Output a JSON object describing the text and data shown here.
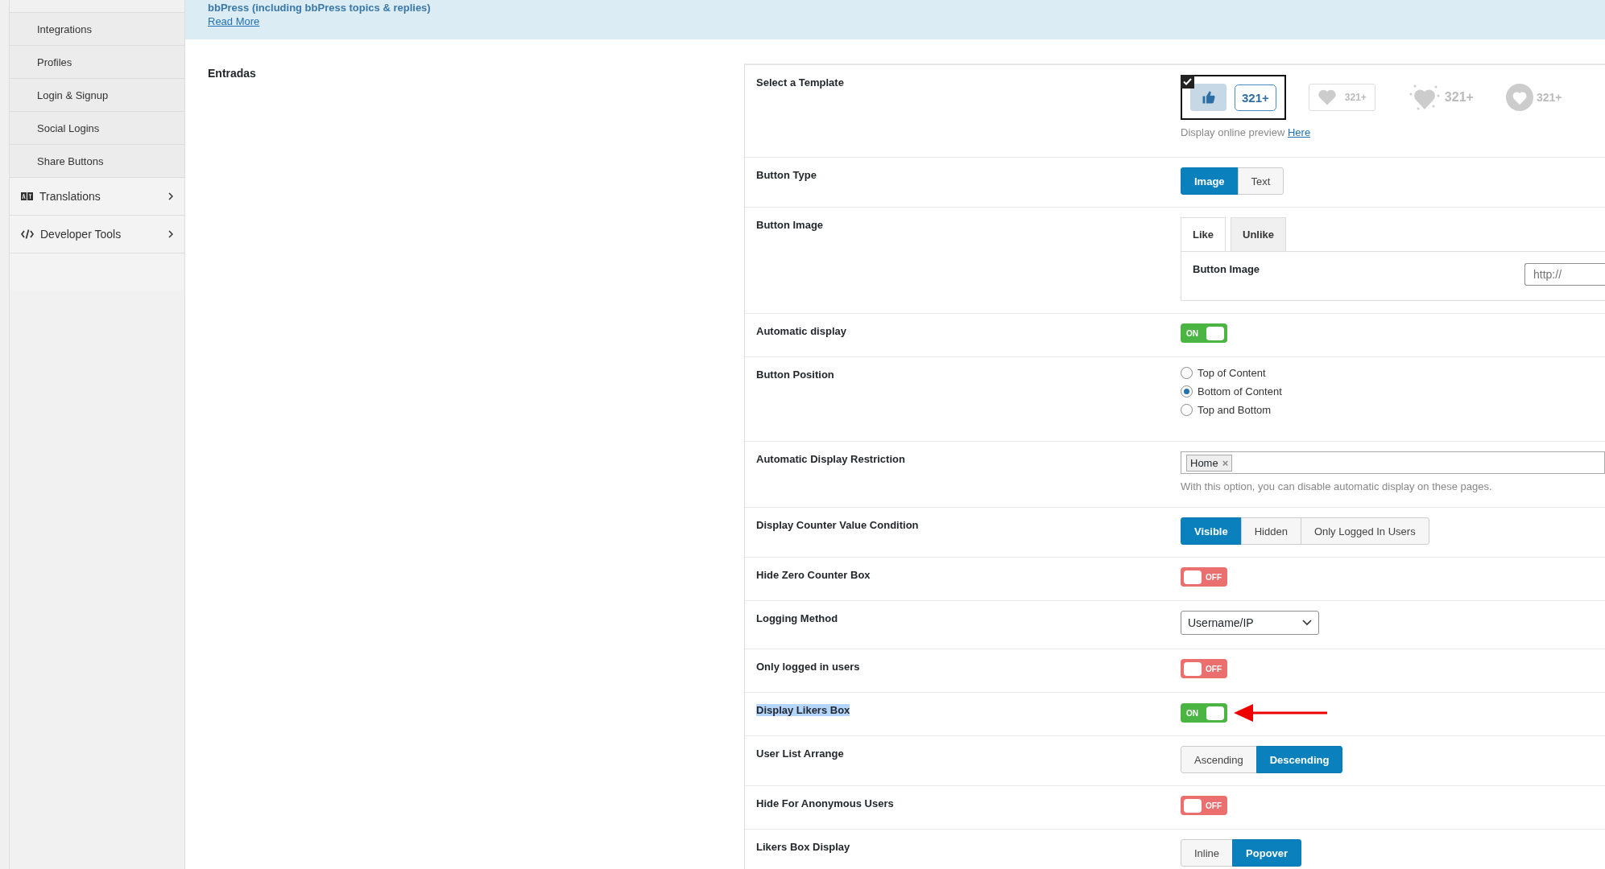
{
  "sidebar": {
    "items": [
      {
        "label": "Integrations",
        "kind": "sub"
      },
      {
        "label": "Profiles",
        "kind": "sub"
      },
      {
        "label": "Login & Signup",
        "kind": "sub"
      },
      {
        "label": "Social Logins",
        "kind": "sub"
      },
      {
        "label": "Share Buttons",
        "kind": "sub"
      },
      {
        "label": "Translations",
        "kind": "translations"
      },
      {
        "label": "Developer Tools",
        "kind": "tools"
      }
    ]
  },
  "banner": {
    "text": "bbPress (including bbPress topics & replies)",
    "link": "Read More"
  },
  "section_title": "Entradas",
  "settings": [
    {
      "kind": "template",
      "label": "Select a Template",
      "templates": [
        {
          "kind": "thumb",
          "count": "321+",
          "selected": true
        },
        {
          "kind": "boxed",
          "count": "321+",
          "selected": false
        },
        {
          "kind": "burst",
          "count": "321+",
          "selected": false
        },
        {
          "kind": "circle",
          "count": "321+",
          "selected": false
        }
      ],
      "hint": "Display online preview",
      "hint_link": "Here"
    },
    {
      "kind": "segmented",
      "label": "Button Type",
      "options": [
        {
          "label": "Image",
          "selected": true
        },
        {
          "label": "Text",
          "selected": false
        }
      ]
    },
    {
      "kind": "tabs",
      "label": "Button Image",
      "tabs": [
        {
          "label": "Like",
          "selected": true
        },
        {
          "label": "Unlike",
          "selected": false
        }
      ],
      "field_label": "Button Image",
      "field_placeholder": "http://"
    },
    {
      "kind": "toggle",
      "label": "Automatic display",
      "on": true,
      "text": "ON"
    },
    {
      "kind": "radio",
      "label": "Button Position",
      "options": [
        {
          "label": "Top of Content",
          "selected": false
        },
        {
          "label": "Bottom of Content",
          "selected": true
        },
        {
          "label": "Top and Bottom",
          "selected": false
        }
      ]
    },
    {
      "kind": "tags",
      "label": "Automatic Display Restriction",
      "tags": [
        {
          "label": "Home",
          "remove": "×"
        }
      ],
      "hint": "With this option, you can disable automatic display on these pages."
    },
    {
      "kind": "segmented",
      "label": "Display Counter Value Condition",
      "options": [
        {
          "label": "Visible",
          "selected": true
        },
        {
          "label": "Hidden",
          "selected": false
        },
        {
          "label": "Only Logged In Users",
          "selected": false
        }
      ]
    },
    {
      "kind": "toggle",
      "label": "Hide Zero Counter Box",
      "on": false,
      "text": "OFF"
    },
    {
      "kind": "select",
      "label": "Logging Method",
      "value": "Username/IP"
    },
    {
      "kind": "toggle",
      "label": "Only logged in users",
      "on": false,
      "text": "OFF"
    },
    {
      "kind": "toggle",
      "label": "Display Likers Box",
      "on": true,
      "text": "ON",
      "highlighted": true,
      "annotated": true
    },
    {
      "kind": "segmented",
      "label": "User List Arrange",
      "options": [
        {
          "label": "Ascending",
          "selected": false
        },
        {
          "label": "Descending",
          "selected": true
        }
      ]
    },
    {
      "kind": "toggle",
      "label": "Hide For Anonymous Users",
      "on": false,
      "text": "OFF"
    },
    {
      "kind": "segmented",
      "label": "Likers Box Display",
      "options": [
        {
          "label": "Inline",
          "selected": false
        },
        {
          "label": "Popover",
          "selected": true
        }
      ]
    }
  ]
}
